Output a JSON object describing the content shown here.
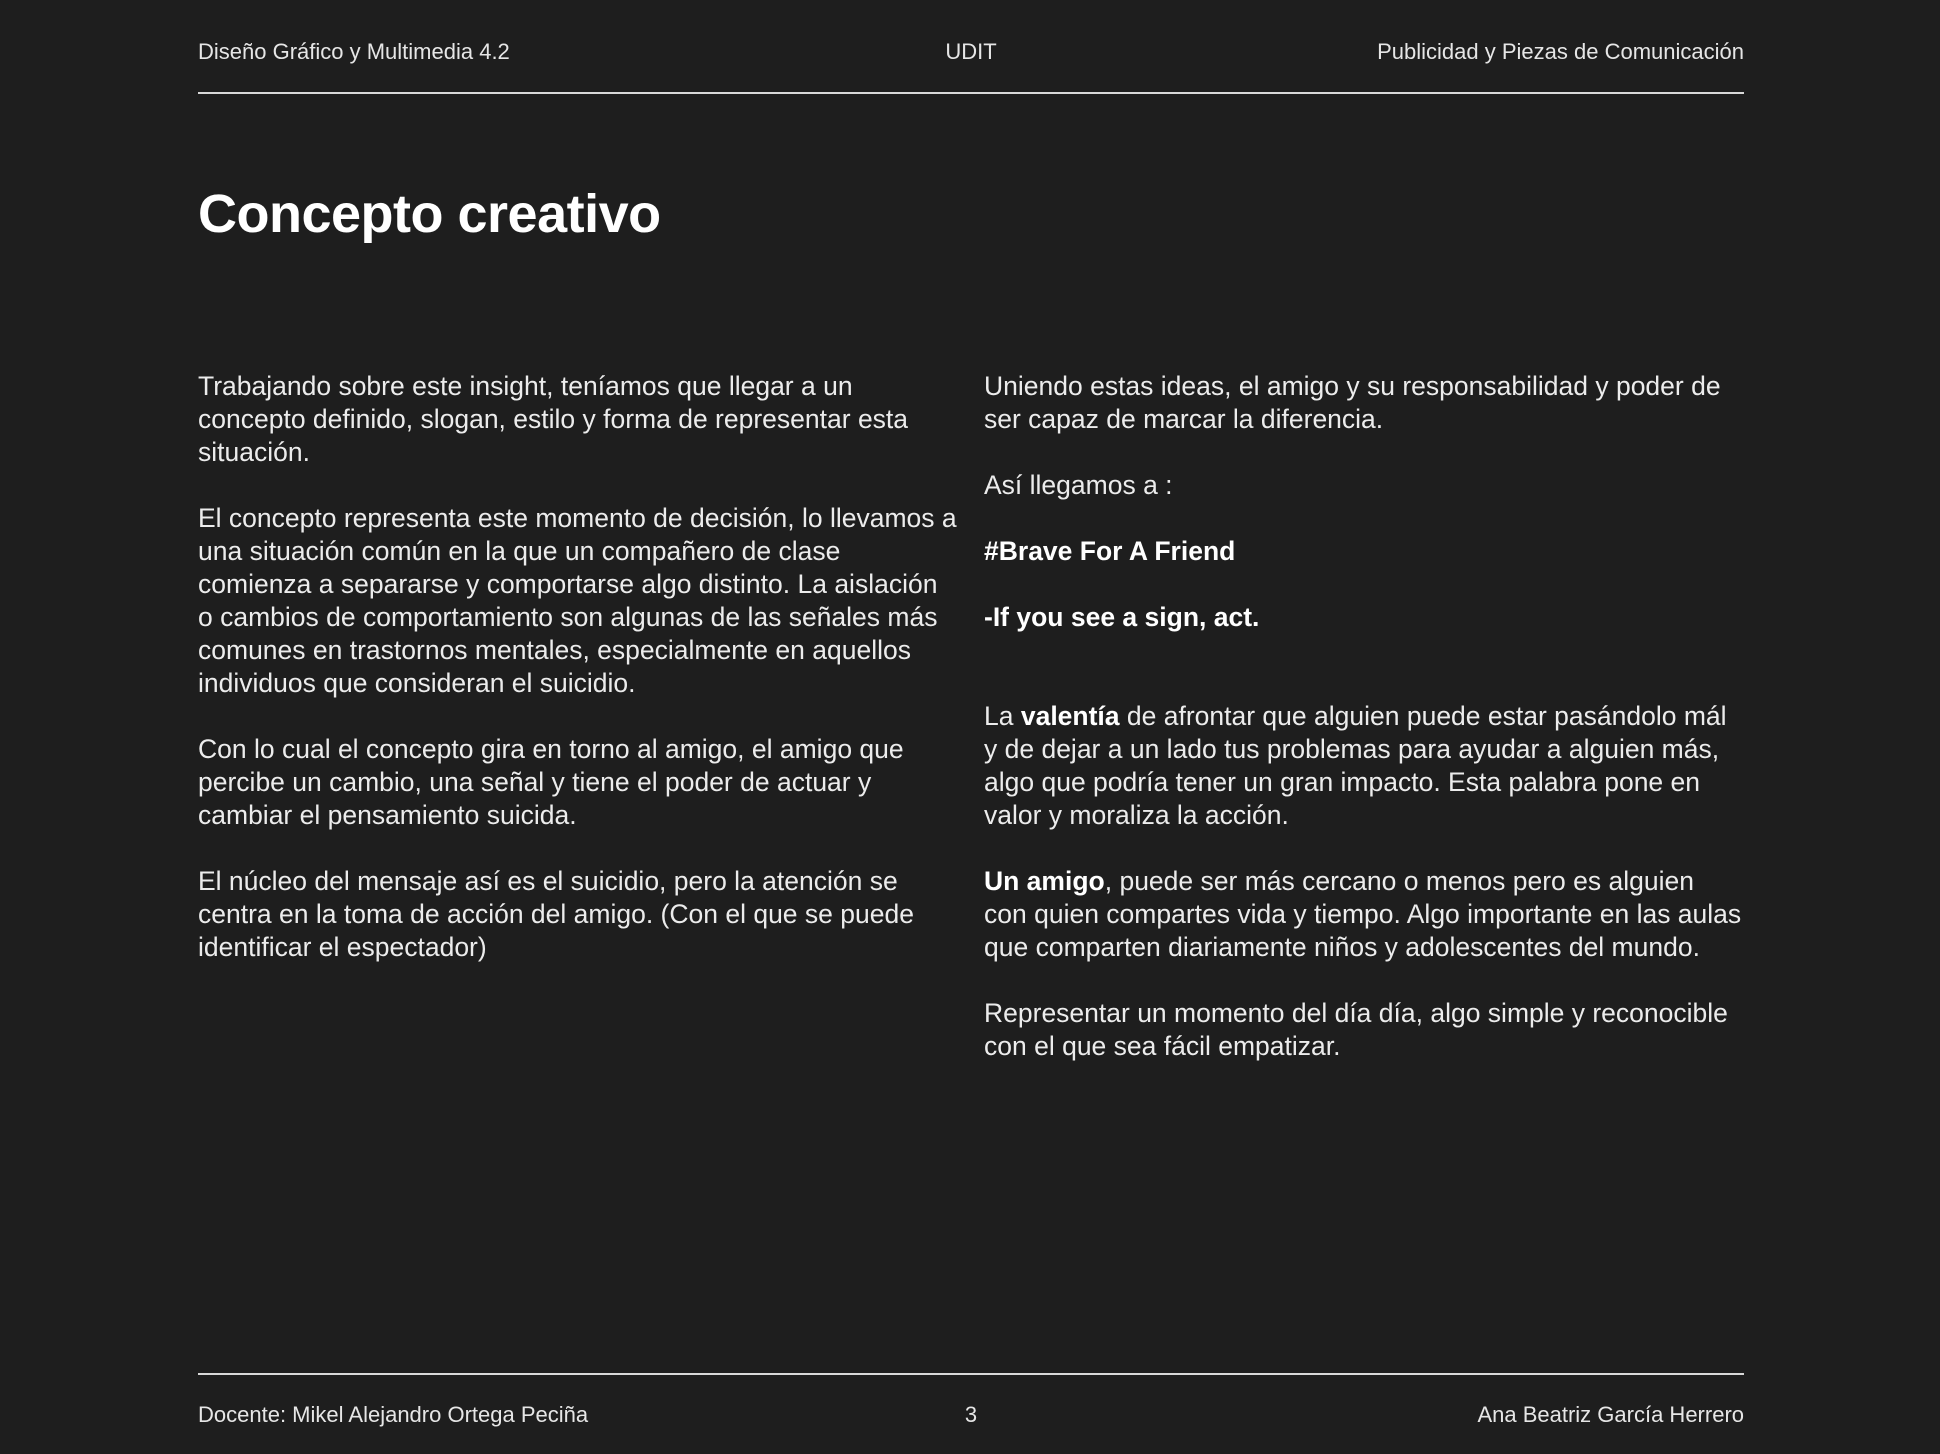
{
  "header": {
    "left": "Diseño Gráfico y Multimedia 4.2",
    "center": "UDIT",
    "right": "Publicidad y Piezas de Comunicación"
  },
  "title": "Concepto creativo",
  "left_column": {
    "p1": "Trabajando sobre este insight, teníamos que llegar a un concepto definido, slogan, estilo y forma de representar esta situación.",
    "p2": "El concepto representa este momento de decisión, lo llevamos a una situación común en la que un compañero de clase comienza a separarse y comportarse algo distinto. La aislación o cambios de comportamiento son algunas de las señales más comunes en trastornos mentales, especialmente en aquellos individuos que consideran el suicidio.",
    "p3": "Con lo cual el concepto gira en torno al amigo, el amigo que percibe un cambio, una señal y tiene el poder de actuar y cambiar el pensamiento suicida.",
    "p4": "El núcleo del mensaje así es el suicidio, pero la atención se centra en la toma de acción del amigo. (Con el que se puede identificar el espectador)"
  },
  "right_column": {
    "p1": "Uniendo estas ideas, el amigo y su responsabilidad y poder de ser capaz de marcar la diferencia.",
    "p2": "Así llegamos a :",
    "hashtag": "#Brave For A Friend",
    "slogan": "-If you see a sign, act.",
    "p3_pre": "La ",
    "p3_bold": "valentía",
    "p3_post": " de afrontar que alguien puede estar pasándolo mál y de dejar a un lado tus problemas para ayudar a alguien más, algo que podría tener un gran impacto. Esta palabra pone en valor y moraliza la acción.",
    "p4_bold": "Un amigo",
    "p4_post": ", puede ser más cercano o menos pero es alguien con quien compartes vida y tiempo. Algo importante en las aulas que comparten diariamente niños y adolescentes del mundo.",
    "p5": "Representar un momento del día día, algo simple y reconocible con el que sea fácil empatizar."
  },
  "footer": {
    "left": "Docente: Mikel Alejandro Ortega Peciña",
    "center": "3",
    "right": "Ana Beatriz García Herrero"
  }
}
